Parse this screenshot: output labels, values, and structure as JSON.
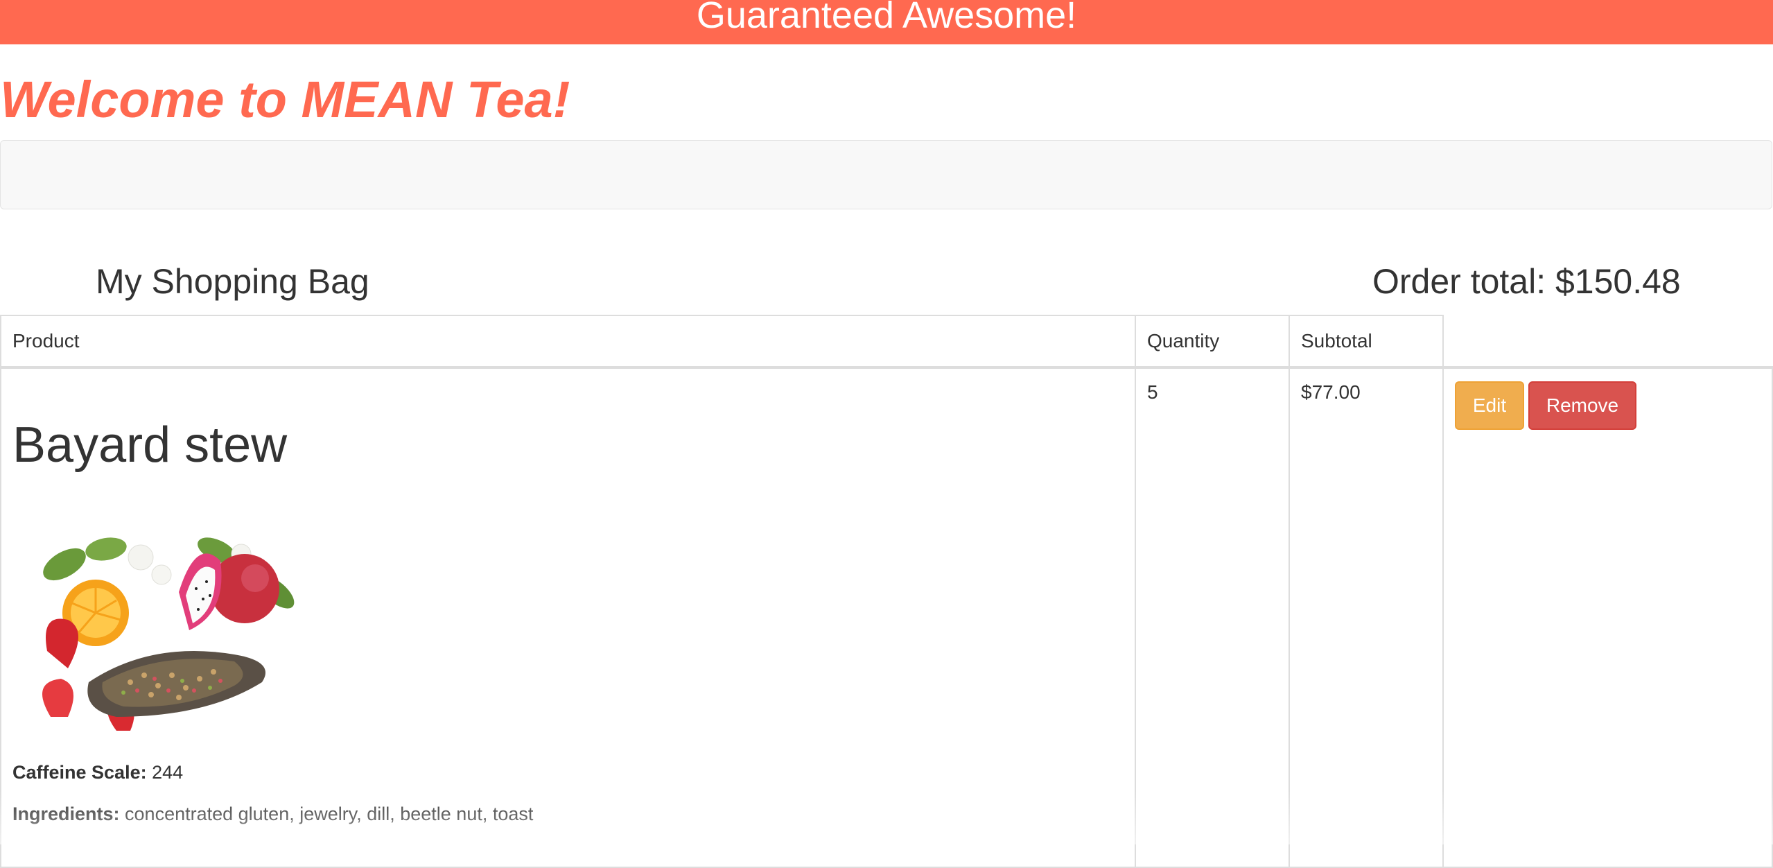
{
  "banner": {
    "text": "Guaranteed Awesome!"
  },
  "header": {
    "welcome": "Welcome to MEAN Tea!"
  },
  "bag": {
    "title": "My Shopping Bag",
    "order_total": "Order total: $150.48"
  },
  "table": {
    "columns": [
      "Product",
      "Quantity",
      "Subtotal"
    ],
    "rows": [
      {
        "product_name": "Bayard stew",
        "caffeine_label": "Caffeine Scale:",
        "caffeine_value": "244",
        "ingredients_label": "Ingredients:",
        "ingredients_value": "concentrated gluten, jewelry, dill, beetle nut, toast",
        "quantity": "5",
        "subtotal": "$77.00",
        "edit_label": "Edit",
        "remove_label": "Remove"
      }
    ]
  },
  "colors": {
    "brand": "#ff6950",
    "edit_button": "#f0ad4e",
    "remove_button": "#d9534f",
    "navbar": "#f8f8f8"
  },
  "icons": {
    "product_image": "tea-blend-with-fruit-image"
  }
}
